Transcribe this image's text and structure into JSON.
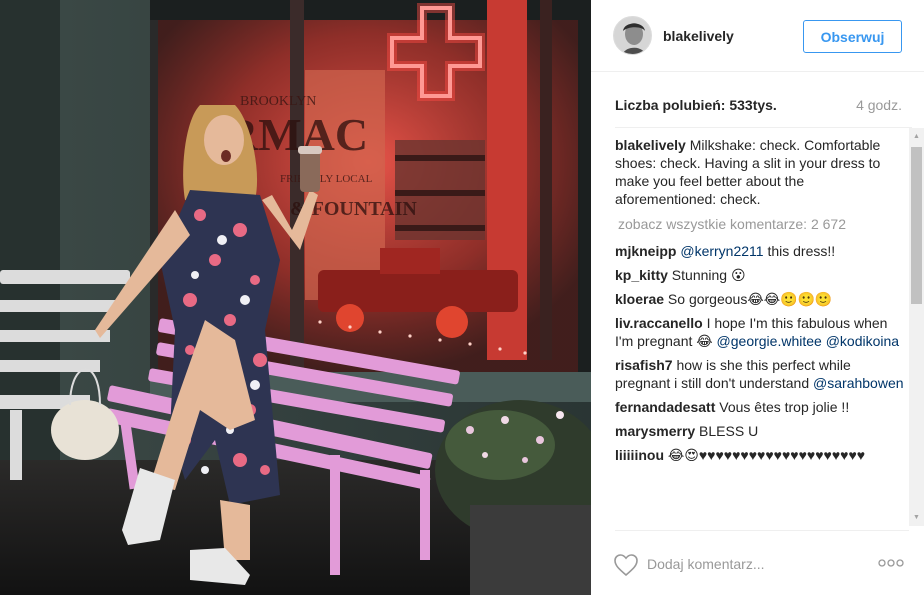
{
  "photo": {
    "sign_text_1": "BROOKLYN",
    "sign_text_2": "RMAC",
    "sign_text_3": "FRIENDLY LOCAL",
    "sign_text_4": "& FOUNTAIN"
  },
  "header": {
    "username": "blakelively",
    "follow_label": "Obserwuj"
  },
  "stats": {
    "likes": "Liczba polubień: 533tys.",
    "time_ago": "4 godz."
  },
  "caption": {
    "username": "blakelively",
    "text": " Milkshake: check. Comfortable shoes: check. Having a slit in your dress to make you feel better about the aforementioned: check."
  },
  "load_more": "zobacz wszystkie komentarze: 2 672",
  "comments": [
    {
      "user": "mjkneipp",
      "m1": "@kerryn2211",
      "t1": " this dress!!"
    },
    {
      "user": "kp_kitty",
      "t0": " Stunning 😮"
    },
    {
      "user": "kloerae",
      "t0": " So gorgeous😂😂🙂🙂🙂"
    },
    {
      "user": "liv.raccanello",
      "t0": " I hope I'm this fabulous when I'm pregnant 😂 ",
      "m1": "@georgie.whitee",
      "t1": " ",
      "m2": "@kodikoina"
    },
    {
      "user": "risafish7",
      "t0": " how is she this perfect while pregnant i still don't understand ",
      "m1": "@sarahbowen"
    },
    {
      "user": "fernandadesatt",
      "t0": " Vous êtes trop jolie !!"
    },
    {
      "user": "marysmerry",
      "t0": " BLESS U"
    },
    {
      "user": "liiiiinou",
      "t0": " 😂😍♥♥♥♥♥♥♥♥♥♥♥♥♥♥♥♥♥♥♥♥"
    }
  ],
  "footer": {
    "comment_placeholder": "Dodaj komentarz...",
    "more_label": "ooo"
  }
}
